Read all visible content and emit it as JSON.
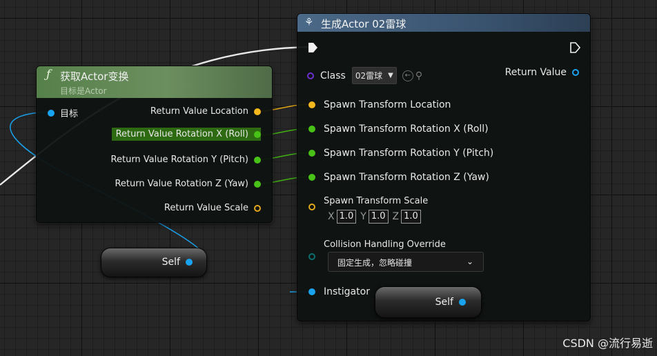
{
  "get_transform_node": {
    "title": "获取Actor变换",
    "subtitle": "目标是Actor",
    "function_icon": "function-icon",
    "input_target": "目标",
    "outputs": {
      "location": "Return Value Location",
      "rotation_x": "Return Value Rotation X (Roll)",
      "rotation_y": "Return Value Rotation Y (Pitch)",
      "rotation_z": "Return Value Rotation Z (Yaw)",
      "scale": "Return Value Scale"
    }
  },
  "self_node_left": {
    "label": "Self"
  },
  "spawn_node": {
    "title": "生成Actor 02雷球",
    "title_icon": "spawn-actor-icon",
    "class_label": "Class",
    "class_value": "02雷球",
    "return_value": "Return Value",
    "spawn_location": "Spawn Transform Location",
    "spawn_rot_x": "Spawn Transform Rotation X (Roll)",
    "spawn_rot_y": "Spawn Transform Rotation Y (Pitch)",
    "spawn_rot_z": "Spawn Transform Rotation Z (Yaw)",
    "spawn_scale": "Spawn Transform Scale",
    "scale_x_label": "X",
    "scale_x": "1.0",
    "scale_y_label": "Y",
    "scale_y": "1.0",
    "scale_z_label": "Z",
    "scale_z": "1.0",
    "collision_label": "Collision Handling Override",
    "collision_value": "固定生成，忽略碰撞",
    "instigator_label": "Instigator"
  },
  "self_node_inner": {
    "label": "Self"
  },
  "watermark": "CSDN @流行易逝",
  "colors": {
    "header_green": "#4b6e3e",
    "header_blue": "#3b5670",
    "pin_blue": "#1aa3f0",
    "pin_yellow": "#f5b81c",
    "pin_green": "#49c217",
    "highlight_green": "#2d6a12"
  }
}
